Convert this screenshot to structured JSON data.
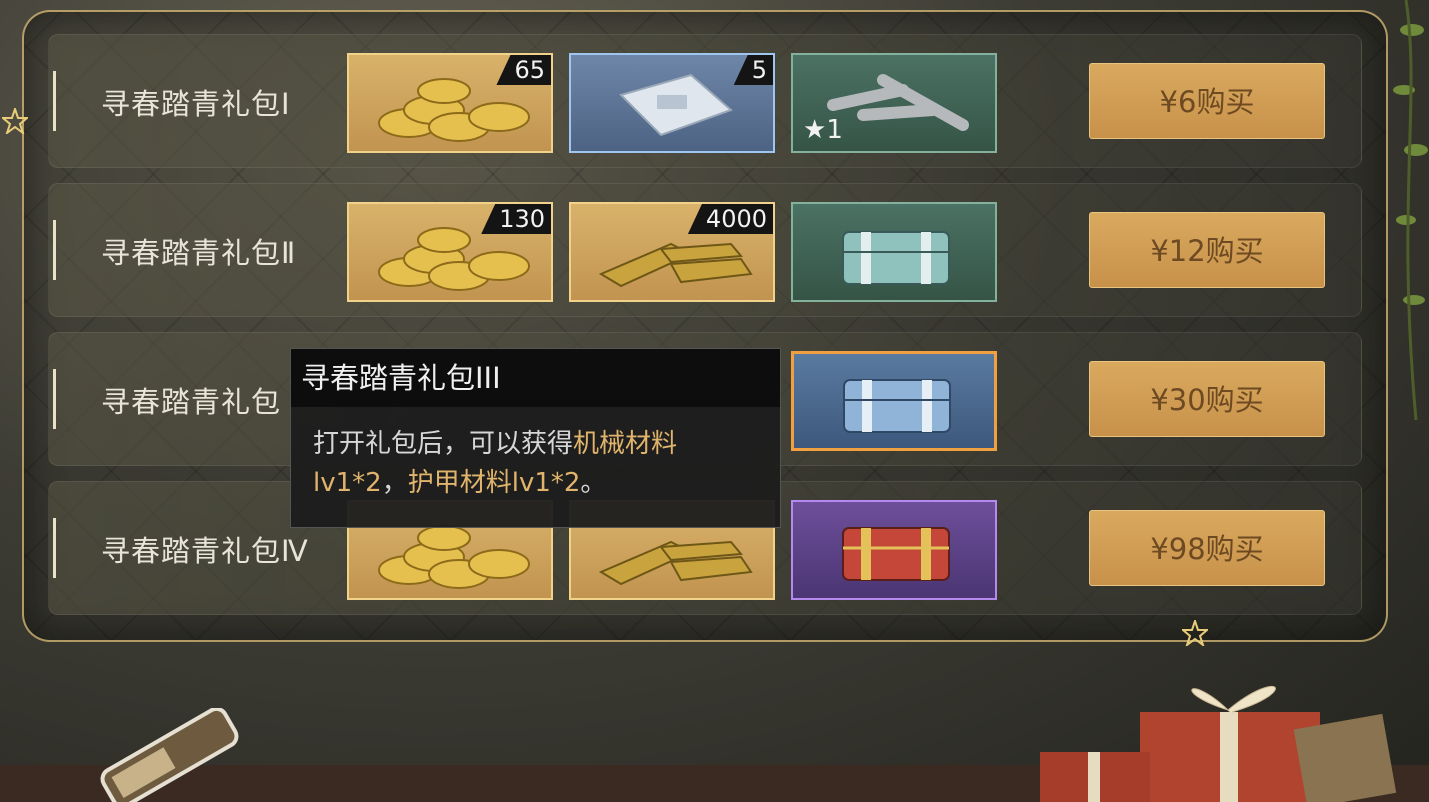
{
  "packs": [
    {
      "name": "寻春踏青礼包Ⅰ",
      "price": "¥6购买",
      "items": [
        {
          "icon": "gold-coins-icon",
          "rarity": "gold",
          "qty": "65"
        },
        {
          "icon": "blueprint-packet-icon",
          "rarity": "blue",
          "qty": "5"
        },
        {
          "icon": "bolts-material-icon",
          "rarity": "green",
          "star_qty": "1"
        }
      ]
    },
    {
      "name": "寻春踏青礼包Ⅱ",
      "price": "¥12购买",
      "items": [
        {
          "icon": "gold-coins-icon",
          "rarity": "gold",
          "qty": "130"
        },
        {
          "icon": "gold-bars-icon",
          "rarity": "gold",
          "qty": "4000"
        },
        {
          "icon": "green-supply-chest-icon",
          "rarity": "green"
        }
      ]
    },
    {
      "name": "寻春踏青礼包",
      "price": "¥30购买",
      "items": [
        {
          "icon": "blue-supply-chest-icon",
          "rarity": "orange"
        }
      ]
    },
    {
      "name": "寻春踏青礼包Ⅳ",
      "price": "¥98购买",
      "items": [
        {
          "icon": "gold-coins-icon",
          "rarity": "gold"
        },
        {
          "icon": "gold-bars-icon",
          "rarity": "gold"
        },
        {
          "icon": "red-supply-chest-icon",
          "rarity": "purple"
        }
      ]
    }
  ],
  "tooltip": {
    "title": "寻春踏青礼包III",
    "body_part1": "打开礼包后，可以获得",
    "body_hl1": "机械材料lv1*2",
    "body_part2": "，",
    "body_hl2": "护甲材料lv1*2",
    "body_part3": "。"
  },
  "colors": {
    "gold_frame": "#f0d28a",
    "buy_button": "#d9a95e",
    "buy_text": "#6e4a22",
    "highlight": "#e0b46c"
  }
}
